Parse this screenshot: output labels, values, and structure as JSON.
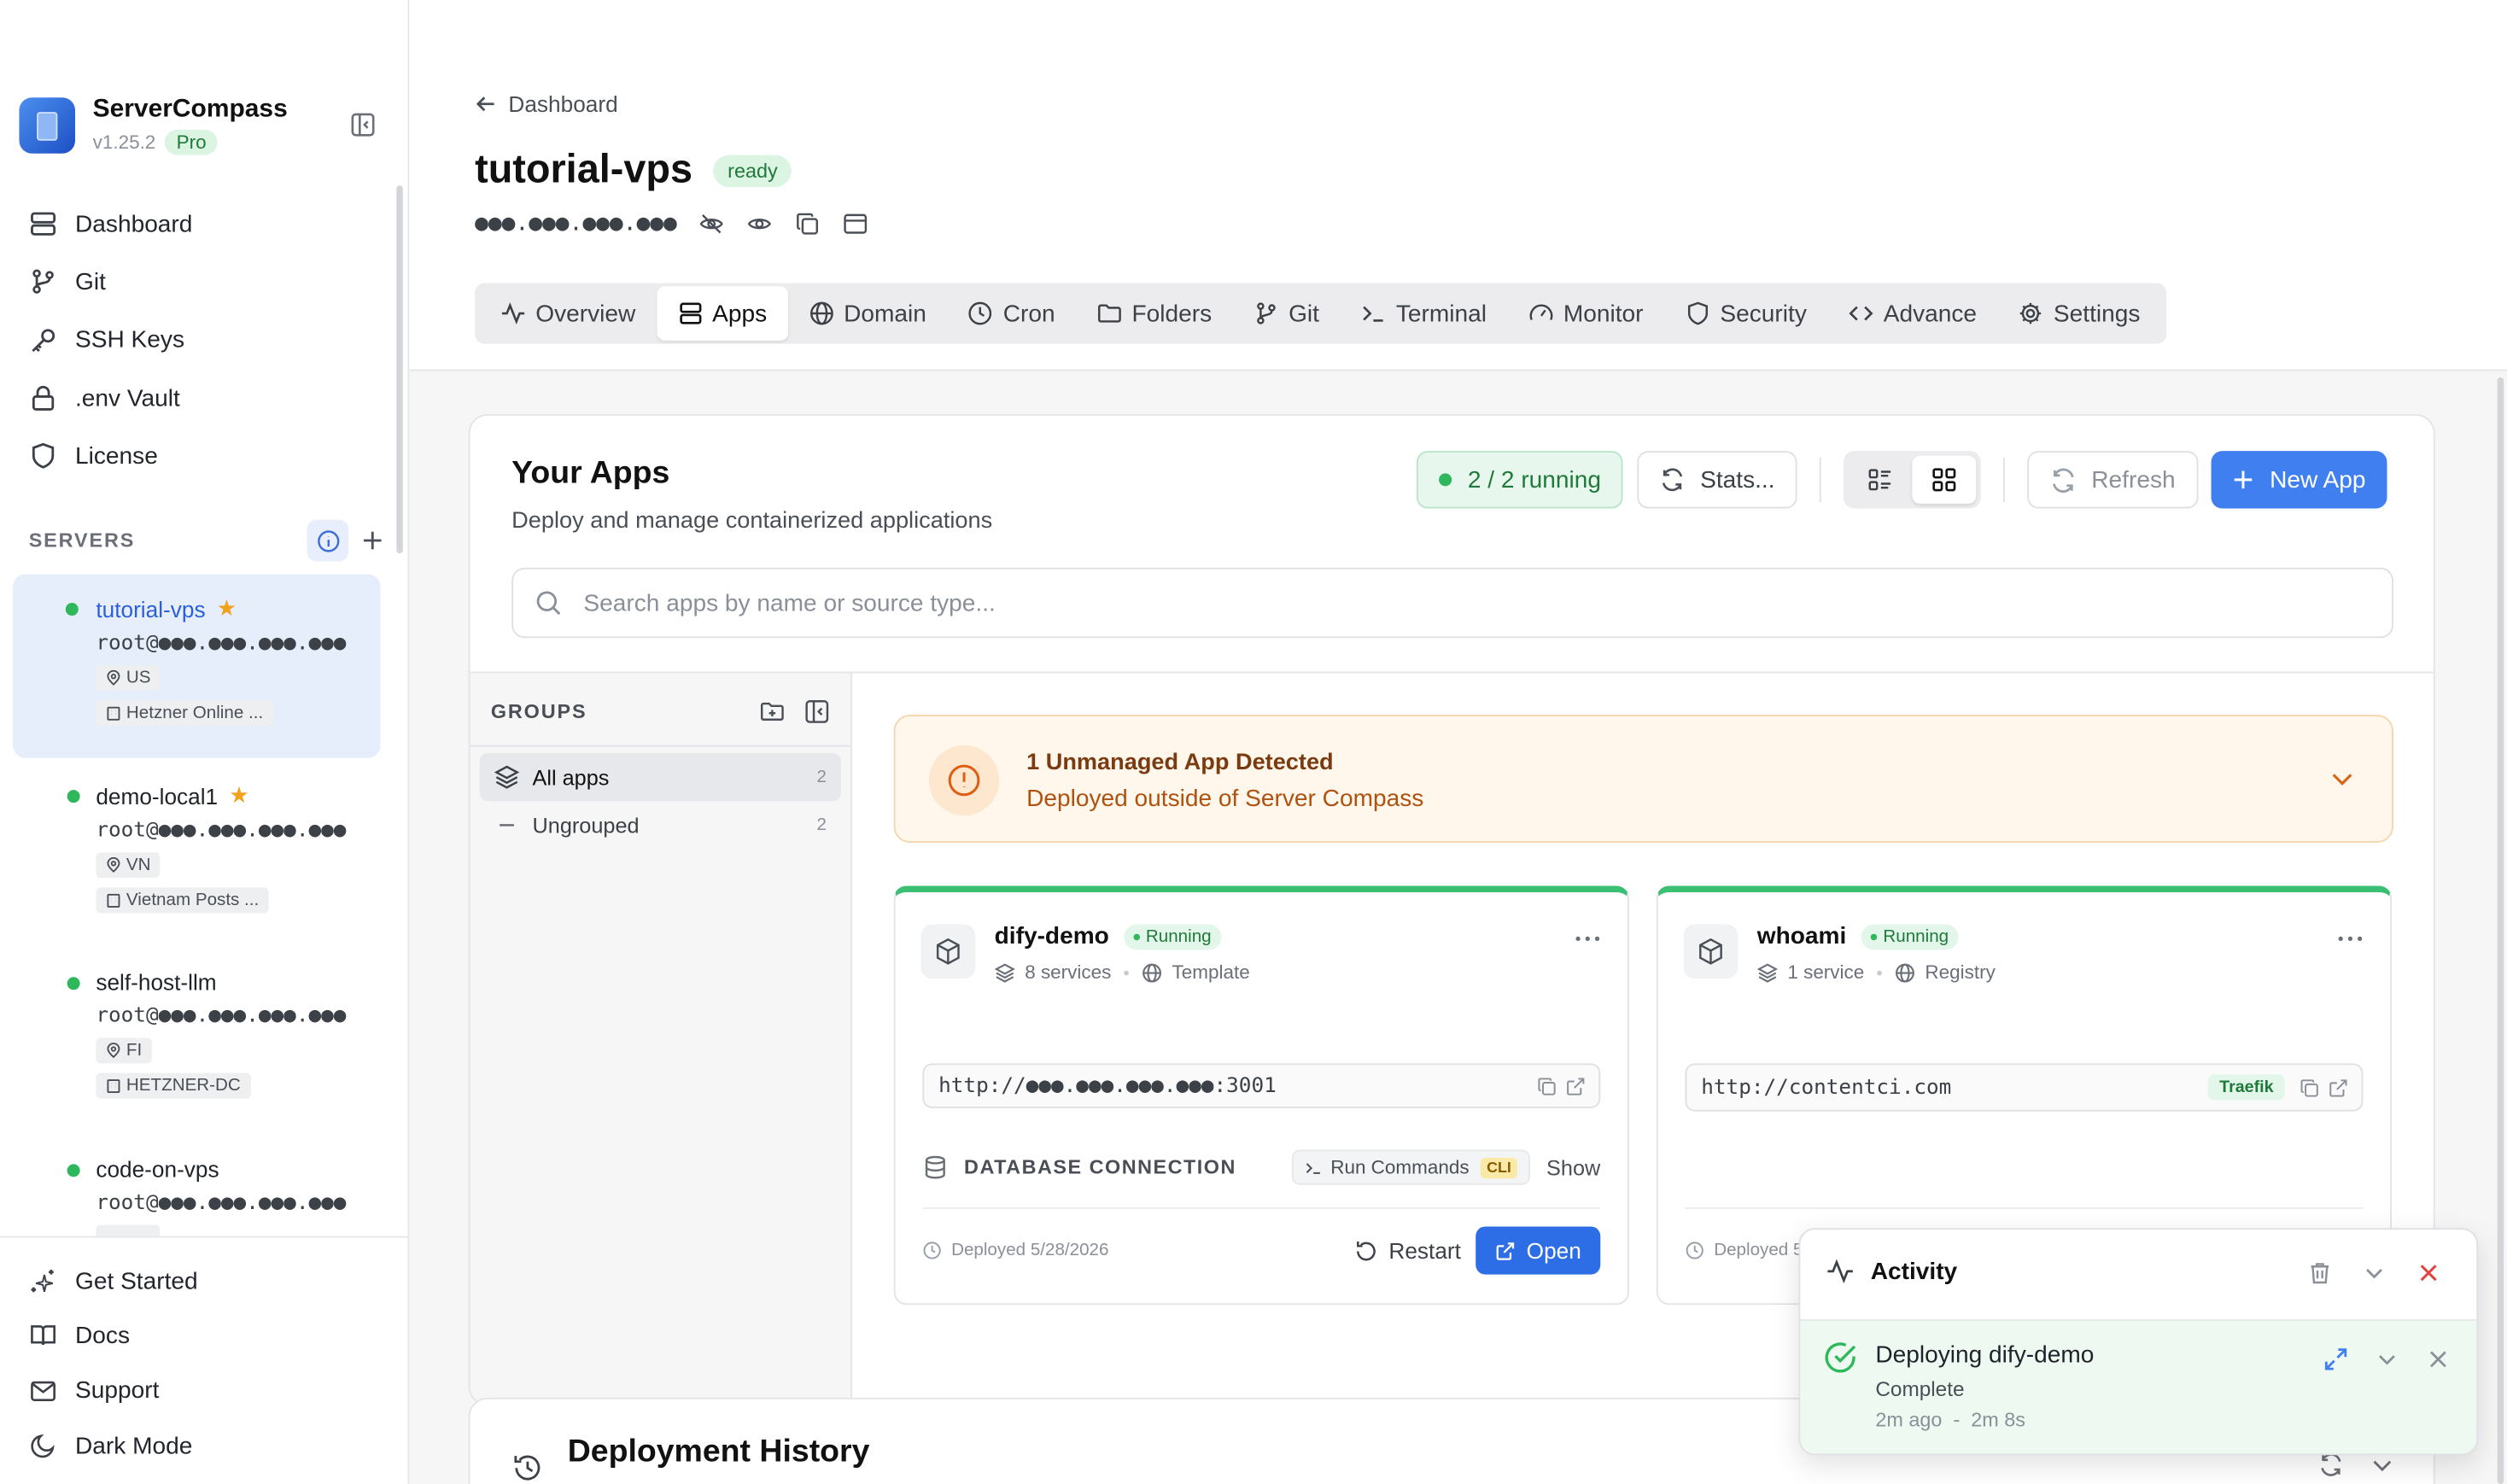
{
  "brand": {
    "name": "ServerCompass",
    "version": "v1.25.2",
    "plan": "Pro"
  },
  "nav": [
    {
      "label": "Dashboard",
      "icon": "server-icon"
    },
    {
      "label": "Git",
      "icon": "git-branch-icon"
    },
    {
      "label": "SSH Keys",
      "icon": "key-icon"
    },
    {
      "label": ".env Vault",
      "icon": "lock-icon"
    },
    {
      "label": "License",
      "icon": "shield-icon"
    }
  ],
  "servers_label": "SERVERS",
  "servers": [
    {
      "name": "tutorial-vps",
      "user": "root@●●●.●●●.●●●.●●●",
      "region": "US",
      "provider": "Hetzner Online ...",
      "starred": true,
      "status_color": "#2fb75c"
    },
    {
      "name": "demo-local1",
      "user": "root@●●●.●●●.●●●.●●●",
      "region": "VN",
      "provider": "Vietnam Posts ...",
      "starred": true,
      "status_color": "#2fb75c"
    },
    {
      "name": "self-host-llm",
      "user": "root@●●●.●●●.●●●.●●●",
      "region": "FI",
      "provider": "HETZNER-DC",
      "starred": false,
      "status_color": "#2fb75c"
    },
    {
      "name": "code-on-vps",
      "user": "root@●●●.●●●.●●●.●●●",
      "region": "",
      "provider": "",
      "starred": false,
      "status_color": "#2fb75c"
    }
  ],
  "bottom_nav": [
    {
      "label": "Get Started",
      "icon": "sparkles-icon"
    },
    {
      "label": "Docs",
      "icon": "book-icon"
    },
    {
      "label": "Support",
      "icon": "mail-icon"
    },
    {
      "label": "Dark Mode",
      "icon": "moon-icon"
    }
  ],
  "header": {
    "back_label": "Dashboard",
    "title": "tutorial-vps",
    "status": "ready",
    "ip_masked": "●●●.●●●.●●●.●●●"
  },
  "tabs": [
    {
      "label": "Overview",
      "icon": "activity-icon"
    },
    {
      "label": "Apps",
      "icon": "server-icon",
      "active": true
    },
    {
      "label": "Domain",
      "icon": "globe-icon"
    },
    {
      "label": "Cron",
      "icon": "clock-icon"
    },
    {
      "label": "Folders",
      "icon": "folder-icon"
    },
    {
      "label": "Git",
      "icon": "git-branch-icon"
    },
    {
      "label": "Terminal",
      "icon": "terminal-icon"
    },
    {
      "label": "Monitor",
      "icon": "gauge-icon"
    },
    {
      "label": "Security",
      "icon": "shield-icon"
    },
    {
      "label": "Advance",
      "icon": "code-icon"
    },
    {
      "label": "Settings",
      "icon": "gear-icon"
    }
  ],
  "apps_panel": {
    "title": "Your Apps",
    "subtitle": "Deploy and manage containerized applications",
    "running": "2 / 2 running",
    "stats_label": "Stats...",
    "refresh_label": "Refresh",
    "new_app_label": "New App",
    "search_placeholder": "Search apps by name or source type...",
    "accent": "#3f7ff0"
  },
  "groups": {
    "label": "GROUPS",
    "items": [
      {
        "label": "All apps",
        "count": "2",
        "active": true
      },
      {
        "label": "Ungrouped",
        "count": "2",
        "active": false
      }
    ]
  },
  "alert": {
    "title": "1 Unmanaged App Detected",
    "subtitle": "Deployed outside of Server Compass"
  },
  "apps": [
    {
      "name": "dify-demo",
      "status": "Running",
      "services": "8 services",
      "source": "Template",
      "url": "http://●●●.●●●.●●●.●●●:3001",
      "db_label": "DATABASE CONNECTION",
      "run_commands": "Run Commands",
      "cli": "CLI",
      "show": "Show",
      "deployed": "Deployed 5/28/2026",
      "restart": "Restart",
      "open": "Open"
    },
    {
      "name": "whoami",
      "status": "Running",
      "services": "1 service",
      "source": "Registry",
      "url": "http://contentci.com",
      "proxy": "Traefik",
      "deployed": "Deployed 5"
    }
  ],
  "history": {
    "title": "Deployment History"
  },
  "activity": {
    "title": "Activity",
    "item_title": "Deploying dify-demo",
    "item_status": "Complete",
    "item_ago": "2m ago",
    "item_sep": "-",
    "item_duration": "2m 8s"
  }
}
